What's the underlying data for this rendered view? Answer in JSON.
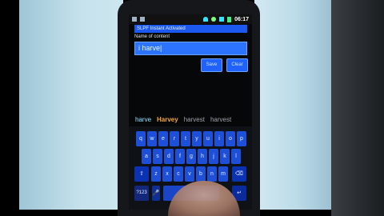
{
  "status_bar": {
    "time": "06:17"
  },
  "app": {
    "title": "SLPF Instant Activated",
    "field_label": "Name of content",
    "input_value": "i harve|",
    "buttons": [
      "Save",
      "Clear"
    ]
  },
  "suggestions": [
    "harve",
    "Harvey",
    "harvest",
    "harvest"
  ],
  "keyboard": {
    "row1": [
      "q",
      "w",
      "e",
      "r",
      "t",
      "y",
      "u",
      "i",
      "o",
      "p"
    ],
    "row2": [
      "a",
      "s",
      "d",
      "f",
      "g",
      "h",
      "j",
      "k",
      "l"
    ],
    "row3": [
      "z",
      "x",
      "c",
      "v",
      "b",
      "n",
      "m"
    ],
    "shift_label": "⇧",
    "delete_label": "⌫",
    "symbols_label": "?123",
    "mic_label": "🎤",
    "enter_label": "↵"
  },
  "colors": {
    "accent": "#1b59f0",
    "key": "#1e4fd8",
    "suggestion_highlight": "#f3a43a"
  }
}
